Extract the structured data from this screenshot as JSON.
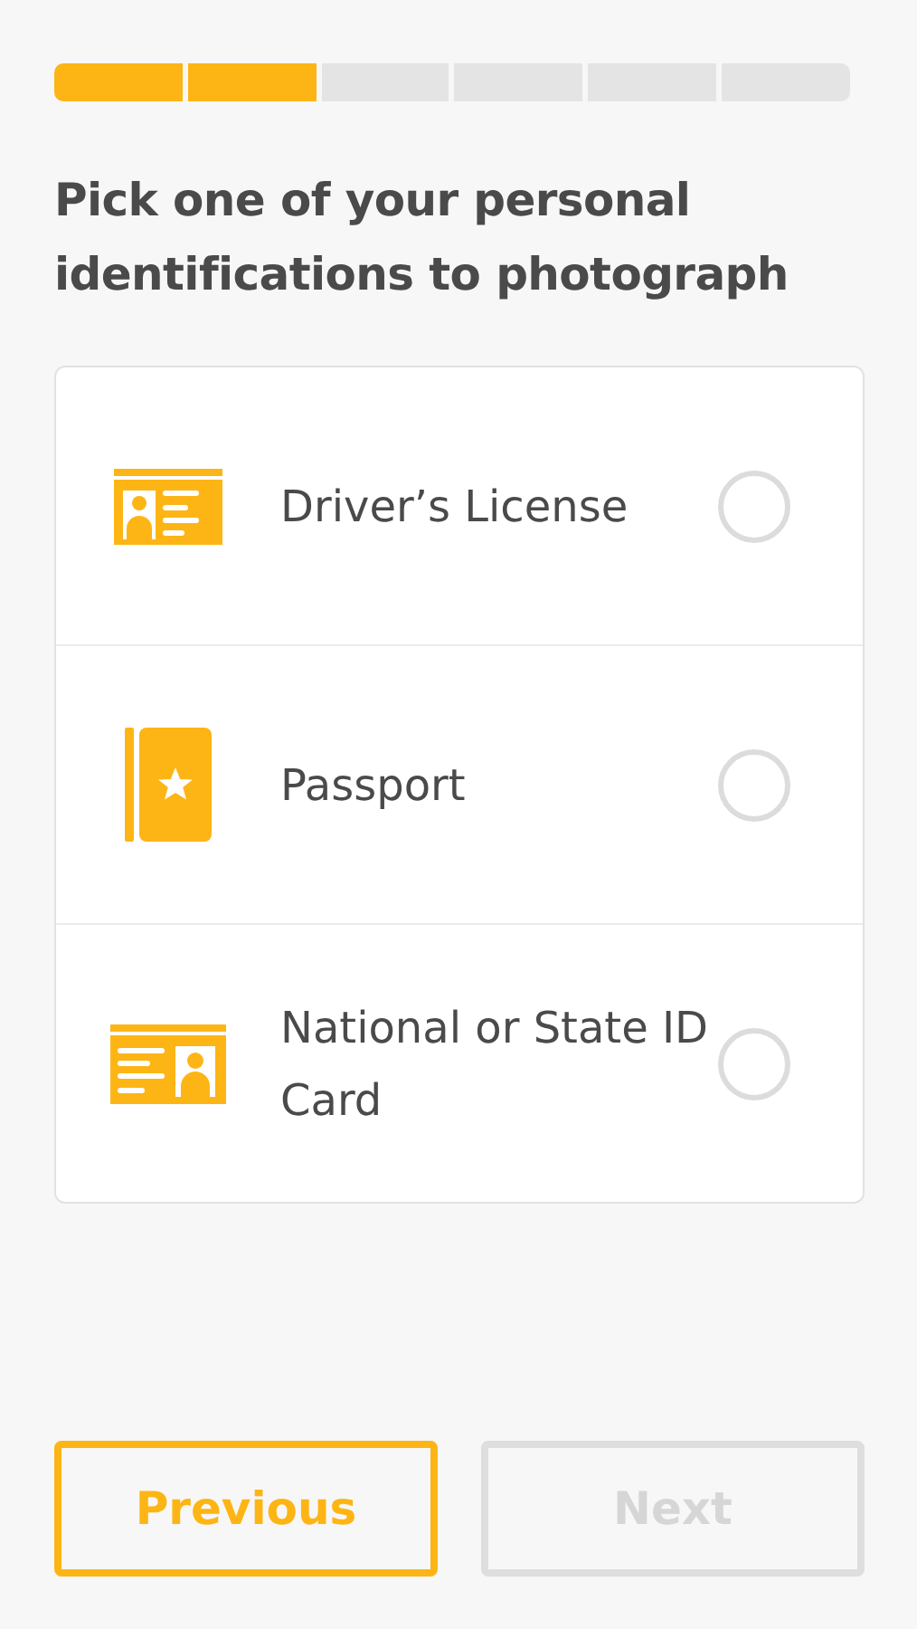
{
  "progress": {
    "steps": [
      {
        "done": true
      },
      {
        "done": true
      },
      {
        "done": false
      },
      {
        "done": false
      },
      {
        "done": false
      },
      {
        "done": false
      }
    ]
  },
  "title": "Pick one of your personal identifications to photograph",
  "options": [
    {
      "kind": "license",
      "label": "Driver’s License",
      "selected": false
    },
    {
      "kind": "passport",
      "label": "Passport",
      "selected": false
    },
    {
      "kind": "national",
      "label": "National or State ID Card",
      "selected": false
    }
  ],
  "buttons": [
    {
      "label": "Previous",
      "disabled": false
    },
    {
      "label": "Next",
      "disabled": true
    }
  ]
}
